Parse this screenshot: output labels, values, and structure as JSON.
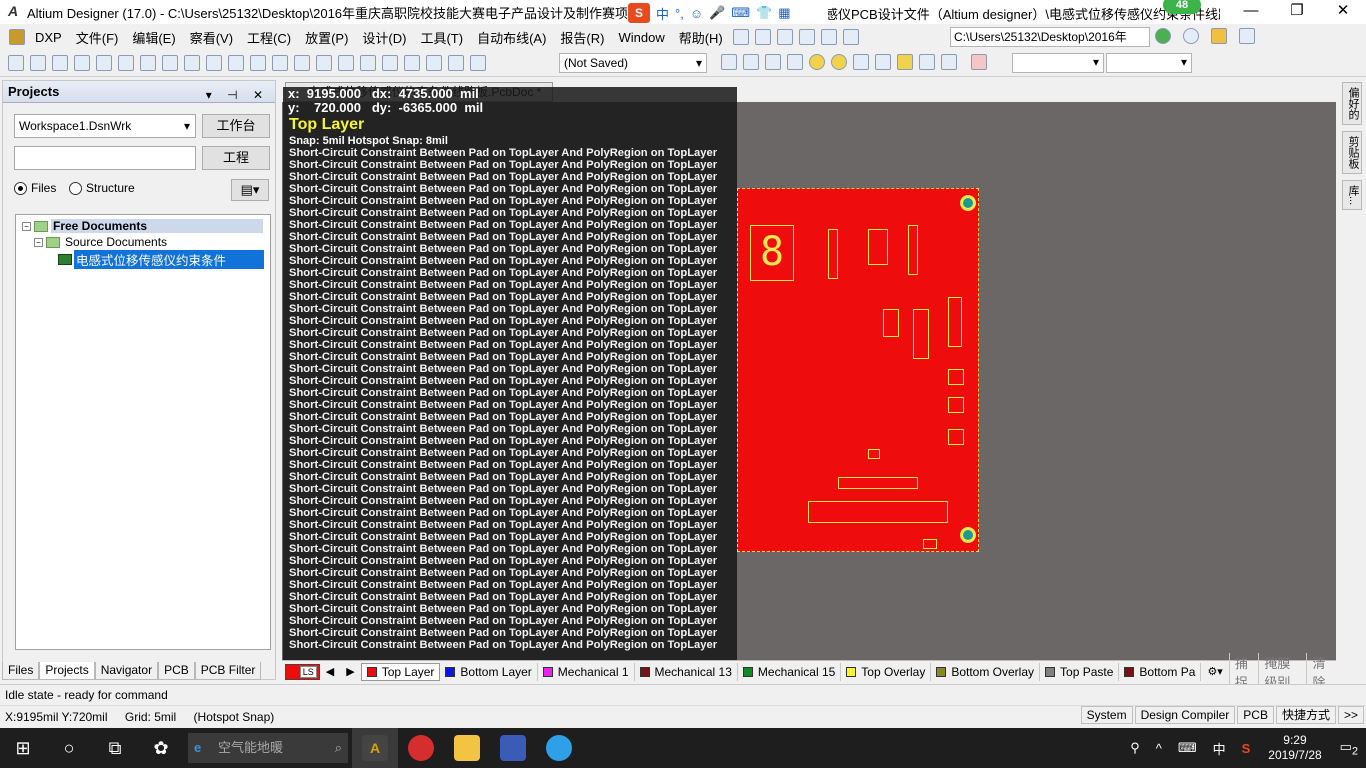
{
  "window": {
    "title": "Altium Designer (17.0) - C:\\Users\\25132\\Desktop\\2016年重庆高职院校技能大赛电子产品设计及制作赛项下发",
    "title_tail": "感仪PCB设计文件（Altium designer）\\电感式位移传感仪约束条件线路...",
    "minimize": "—",
    "restore": "❐",
    "close": "✕"
  },
  "ime": {
    "logo": "S",
    "lang": "中",
    "punct": "°,",
    "badge": "48"
  },
  "menu": {
    "items": [
      "DXP",
      "文件(F)",
      "编辑(E)",
      "察看(V)",
      "工程(C)",
      "放置(P)",
      "设计(D)",
      "工具(T)",
      "自动布线(A)",
      "报告(R)",
      "Window",
      "帮助(H)"
    ],
    "path": "C:\\Users\\25132\\Desktop\\2016年"
  },
  "toolbar": {
    "saved_state": "(Not Saved)"
  },
  "projects_panel": {
    "title": "Projects",
    "header_controls": "▾ ⊣ ✕",
    "workspace": "Workspace1.DsnWrk",
    "workspace_button": "工作台",
    "project_button": "工程",
    "radio_files": "Files",
    "radio_structure": "Structure",
    "tree": {
      "root": "Free Documents",
      "child": "Source Documents",
      "file": "电感式位移传感仪约束条件"
    },
    "tabs": [
      "Files",
      "Projects",
      "Navigator",
      "PCB",
      "PCB Filter"
    ]
  },
  "document": {
    "tab": "电感式位移传感仪约束条件线路板.PcbDoc *"
  },
  "overlay": {
    "coord_line1": "x:  9195.000   dx:  4735.000  mil",
    "coord_line2": "y:    720.000   dy:  -6365.000  mil",
    "layer": "Top Layer",
    "snap": "Snap: 5mil Hotspot Snap: 8mil",
    "violation_text": "Short-Circuit Constraint Between Pad on TopLayer And PolyRegion on TopLayer",
    "violation_count": 42
  },
  "pcb": {
    "seven_seg_digit": "8",
    "colors": {
      "board": "#ee0c0c",
      "silk": "#f5e74d",
      "background": "#6b6767"
    }
  },
  "right_dock": [
    "偏好的",
    "剪贴板",
    "库..."
  ],
  "layers": {
    "ls_label": "LS",
    "nav_left": "◀",
    "nav_right": "▶",
    "tabs": [
      {
        "name": "Top Layer",
        "color": "#ee0c0c"
      },
      {
        "name": "Bottom Layer",
        "color": "#0b17e0"
      },
      {
        "name": "Mechanical 1",
        "color": "#e626e6"
      },
      {
        "name": "Mechanical 13",
        "color": "#7a1414"
      },
      {
        "name": "Mechanical 15",
        "color": "#118a1f"
      },
      {
        "name": "Top Overlay",
        "color": "#f5f531"
      },
      {
        "name": "Bottom Overlay",
        "color": "#888822"
      },
      {
        "name": "Top Paste",
        "color": "#808080"
      },
      {
        "name": "Bottom Pa",
        "color": "#7a1010"
      }
    ],
    "right_buttons": [
      "捕捉",
      "掩膜级别",
      "清除"
    ]
  },
  "status": {
    "idle": "Idle state - ready for command",
    "coords": "X:9195mil Y:720mil",
    "grid": "Grid: 5mil",
    "hotspot": "(Hotspot Snap)",
    "panels": [
      "System",
      "Design Compiler",
      "PCB",
      "快捷方式",
      ">>"
    ]
  },
  "taskbar": {
    "search_placeholder": "空气能地暖",
    "time": "9:29",
    "date": "2019/7/28",
    "lang": "中",
    "notif": "2"
  }
}
